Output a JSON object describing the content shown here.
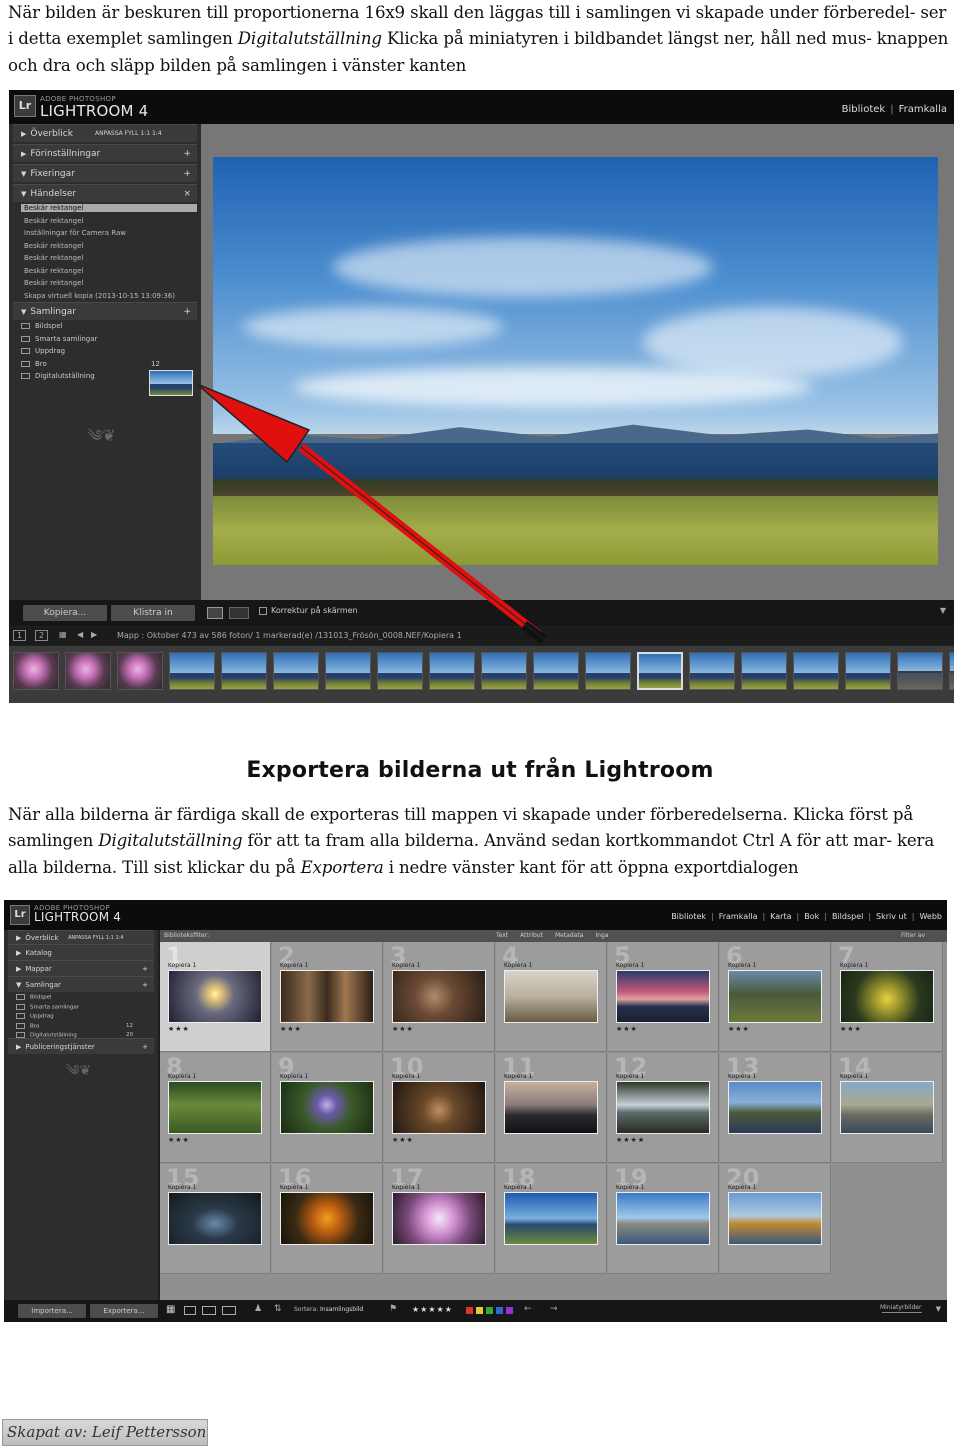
{
  "intro": {
    "text_before": "När bilden är beskuren till proportionerna 16x9 skall den läggas till  i samlingen vi skapade under förberedel- ser i detta exemplet samlingen ",
    "italic": "Digitalutställning",
    "text_after": " Klicka på miniatyren i bildbandet längst ner, håll ned mus- knappen och dra och släpp bilden på samlingen i vänster kanten"
  },
  "screenshot1": {
    "logo": "Lr",
    "adobe": "ADOBE PHOTOSHOP",
    "product": "LIGHTROOM 4",
    "modules": [
      "Bibliotek",
      "Framkalla"
    ],
    "panels": {
      "overblick": "Överblick",
      "overblick_opts": "ANPASSA   FYLL   1:1   1:4",
      "presets": "Förinställningar",
      "snapshots": "Fixeringar",
      "history": "Händelser",
      "history_items": [
        "Beskär rektangel",
        "Beskär rektangel",
        "Inställningar för Camera Raw",
        "Beskär rektangel",
        "Beskär rektangel",
        "Beskär rektangel",
        "Beskär rektangel",
        "Skapa virtuell kopia (2013-10-15 13:09:36)"
      ],
      "collections": "Samlingar",
      "collection_items": [
        {
          "label": "Bildspel",
          "count": ""
        },
        {
          "label": "Smarta samlingar",
          "count": ""
        },
        {
          "label": "Uppdrag",
          "count": ""
        },
        {
          "label": "Bro",
          "count": "12"
        },
        {
          "label": "Digitalutställning",
          "count": ""
        }
      ]
    },
    "buttons": {
      "copy": "Kopiera...",
      "paste": "Klistra in"
    },
    "toolbar_text": "Korrektur på skärmen",
    "nav_text": "Mapp : Oktober   473 av 586 foton/ 1 markerad(e) /131013_Frösön_0008.NEF/Kopiera 1",
    "page_nums": [
      "1",
      "2"
    ]
  },
  "heading": "Exportera bilderna ut från Lightroom",
  "body2": {
    "t1": "När alla bilderna är färdiga skall de exporteras till mappen vi skapade under förberedelserna. Klicka först på samlingen ",
    "i1": "Digitalutställning",
    "t2": " för att ta fram alla bilderna. Använd sedan kortkommandot Ctrl A för att mar- kera alla bilderna. Till sist klickar du på ",
    "i2": "Exportera",
    "t3": " i nedre vänster kant för att öppna exportdialogen"
  },
  "screenshot2": {
    "logo": "Lr",
    "adobe": "ADOBE PHOTOSHOP",
    "product": "LIGHTROOM 4",
    "modules": [
      "Bibliotek",
      "Framkalla",
      "Karta",
      "Bok",
      "Bildspel",
      "Skriv ut",
      "Webb"
    ],
    "panels": {
      "overblick": "Överblick",
      "overblick_opts": "ANPASSA   FYLL   1:1   1:4",
      "catalog": "Katalog",
      "folders": "Mappar",
      "collections": "Samlingar",
      "collection_items": [
        {
          "label": "Bildspel",
          "count": ""
        },
        {
          "label": "Smarta samlingar",
          "count": ""
        },
        {
          "label": "Uppdrag",
          "count": ""
        },
        {
          "label": "Bro",
          "count": "12"
        },
        {
          "label": "Digitalutställning",
          "count": "20"
        }
      ],
      "publish": "Publiceringstjänster"
    },
    "filterbar": {
      "label": "Biblioteksfilter:",
      "tabs": [
        "Text",
        "Attribut",
        "Metadata",
        "Inga"
      ],
      "right": "Filter av"
    },
    "buttons": {
      "import": "Importera...",
      "export": "Exportera..."
    },
    "sort_label": "Sortera:",
    "sort_value": "Insamlingsbild",
    "thumb_label": "Miniatyrbilder",
    "cells": [
      {
        "num": "1",
        "cap": "Kopiera 1",
        "stars": "★★★"
      },
      {
        "num": "2",
        "cap": "Kopiera 1",
        "stars": "★★★"
      },
      {
        "num": "3",
        "cap": "Kopiera 1",
        "stars": "★★★"
      },
      {
        "num": "4",
        "cap": "Kopiera 1",
        "stars": ""
      },
      {
        "num": "5",
        "cap": "Kopiera 1",
        "stars": "★★★"
      },
      {
        "num": "6",
        "cap": "Kopiera 1",
        "stars": "★★★"
      },
      {
        "num": "7",
        "cap": "Kopiera 1",
        "stars": "★★★"
      },
      {
        "num": "8",
        "cap": "Kopiera 1",
        "stars": "★★★"
      },
      {
        "num": "9",
        "cap": "Kopiera 1",
        "stars": ""
      },
      {
        "num": "10",
        "cap": "Kopiera 1",
        "stars": "★★★"
      },
      {
        "num": "11",
        "cap": "Kopiera 1",
        "stars": ""
      },
      {
        "num": "12",
        "cap": "Kopiera 1",
        "stars": "★★★★"
      },
      {
        "num": "13",
        "cap": "Kopiera 1",
        "stars": ""
      },
      {
        "num": "14",
        "cap": "Kopiera 1",
        "stars": ""
      },
      {
        "num": "15",
        "cap": "Kopiera 1",
        "stars": ""
      },
      {
        "num": "16",
        "cap": "Kopiera 1",
        "stars": ""
      },
      {
        "num": "17",
        "cap": "Kopiera 1",
        "stars": ""
      },
      {
        "num": "18",
        "cap": "Kopiera 1",
        "stars": ""
      },
      {
        "num": "19",
        "cap": "Kopiera 1",
        "stars": ""
      },
      {
        "num": "20",
        "cap": "Kopiera 1",
        "stars": ""
      }
    ]
  },
  "signature": "Skapat av: Leif Pettersson",
  "colors": {
    "arrow": "#e01010",
    "lr_bg": "#1e1e1e",
    "panel": "#2d2d2d"
  }
}
